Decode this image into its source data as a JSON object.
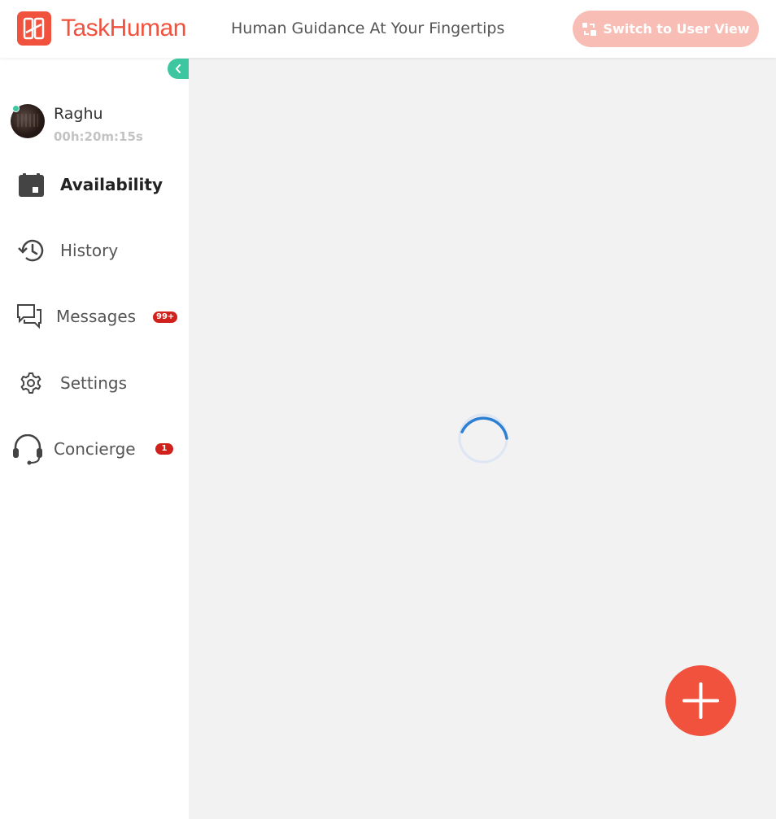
{
  "header": {
    "logo_text": "TaskHuman",
    "tagline": "Human Guidance At Your Fingertips",
    "switch_button_label": "Switch to User View"
  },
  "user": {
    "name": "Raghu",
    "session_timer": "00h:20m:15s",
    "status": "online"
  },
  "nav": {
    "items": [
      {
        "label": "Availability",
        "icon": "calendar-icon",
        "active": true
      },
      {
        "label": "History",
        "icon": "history-icon"
      },
      {
        "label": "Messages",
        "icon": "chat-icon",
        "badge": "99+"
      },
      {
        "label": "Settings",
        "icon": "gear-icon"
      },
      {
        "label": "Concierge",
        "icon": "headset-icon",
        "badge": "1"
      }
    ]
  },
  "colors": {
    "brand": "#f0523e",
    "accent_green": "#3cc7a0",
    "badge_red": "#d0211c",
    "spinner_blue": "#2d7fd3",
    "content_bg": "#f2f2f2"
  },
  "main": {
    "loading": true
  }
}
